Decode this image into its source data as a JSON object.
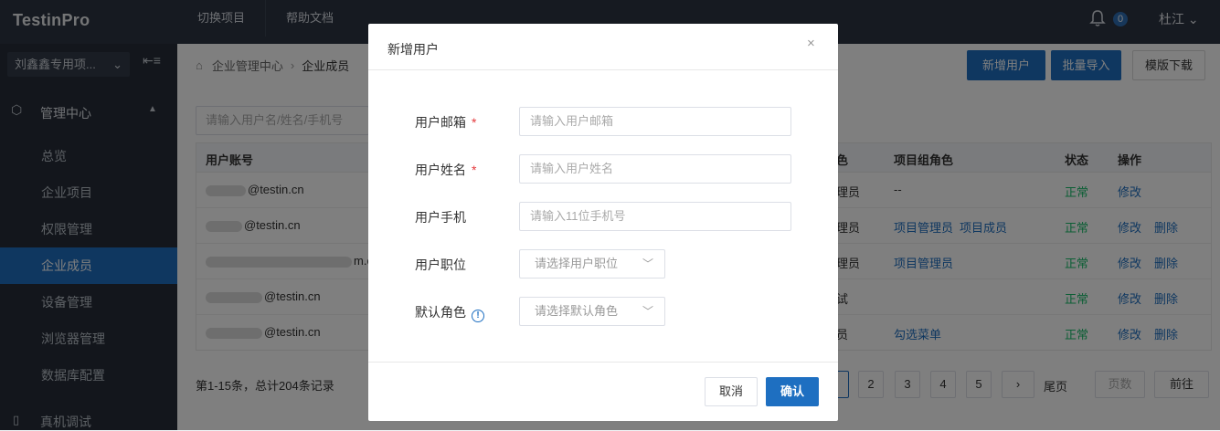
{
  "app": {
    "logo": "TestinPro",
    "nav": [
      "切换项目",
      "帮助文档"
    ],
    "notification_count": "0",
    "user_name": "杜江"
  },
  "sidebar": {
    "project_select": "刘鑫鑫专用项...",
    "menu_head": "管理中心",
    "items": [
      "总览",
      "企业项目",
      "权限管理",
      "企业成员",
      "设备管理",
      "浏览器管理",
      "数据库配置"
    ],
    "active_index": 3,
    "bottom_item": "真机调试"
  },
  "main": {
    "breadcrumb": [
      "企业管理中心",
      "企业成员"
    ],
    "buttons": {
      "add_user": "新增用户",
      "batch_import": "批量导入",
      "template_download": "模版下载"
    },
    "search_placeholder": "请输入用户名/姓名/手机号",
    "table": {
      "headers": {
        "account": "用户账号",
        "role": "色",
        "group_role": "项目组角色",
        "status": "状态",
        "actions": "操作"
      },
      "rows": [
        {
          "account": "@testin.cn",
          "role": "理员",
          "group_role": [
            "--"
          ],
          "status": "正常",
          "actions": [
            "修改"
          ]
        },
        {
          "account": "@testin.cn",
          "role": "理员",
          "group_role": [
            "项目管理员",
            "项目成员"
          ],
          "status": "正常",
          "actions": [
            "修改",
            "删除"
          ]
        },
        {
          "account": "m.c",
          "role": "理员",
          "group_role": [
            "项目管理员"
          ],
          "status": "正常",
          "actions": [
            "修改",
            "删除"
          ]
        },
        {
          "account": "@testin.cn",
          "role": "试",
          "group_role": [],
          "status": "正常",
          "actions": [
            "修改",
            "删除"
          ]
        },
        {
          "account": "@testin.cn",
          "role": "员",
          "group_role": [
            "勾选菜单"
          ],
          "status": "正常",
          "actions": [
            "修改",
            "删除"
          ]
        }
      ]
    },
    "pagination": {
      "summary": "第1-15条，总计204条记录",
      "pages": [
        "2",
        "3",
        "4",
        "5"
      ],
      "next": "›",
      "last": "尾页",
      "page_input_placeholder": "页数",
      "go": "前往"
    }
  },
  "modal": {
    "title": "新增用户",
    "close": "×",
    "fields": {
      "email": {
        "label": "用户邮箱",
        "placeholder": "请输入用户邮箱",
        "required": "*"
      },
      "name": {
        "label": "用户姓名",
        "placeholder": "请输入用户姓名",
        "required": "*"
      },
      "phone": {
        "label": "用户手机",
        "placeholder": "请输入11位手机号"
      },
      "position": {
        "label": "用户职位",
        "placeholder": "请选择用户职位"
      },
      "role": {
        "label": "默认角色",
        "placeholder": "请选择默认角色"
      }
    },
    "cancel": "取消",
    "confirm": "确认"
  },
  "colors": {
    "primary": "#1e6fc1",
    "topbar": "#2d3542",
    "sidebar": "#262d38",
    "success": "#19be6b",
    "required": "#e4393c"
  }
}
